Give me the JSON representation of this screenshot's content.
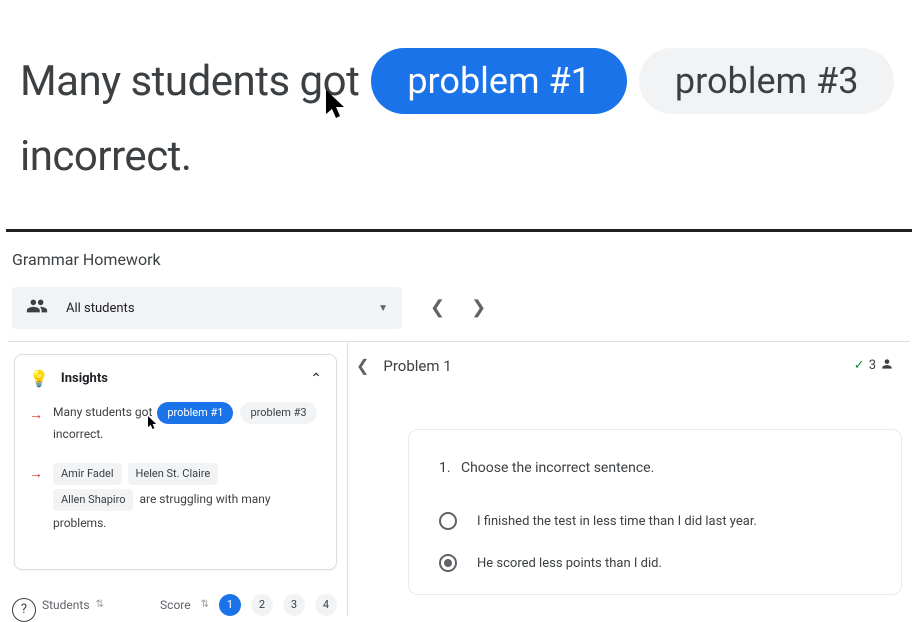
{
  "hero": {
    "prefix": "Many students got",
    "pill1": "problem #1",
    "pill3": "problem #3",
    "suffix": "incorrect."
  },
  "page": {
    "title": "Grammar Homework"
  },
  "toolbar": {
    "dropdown_label": "All students"
  },
  "insights": {
    "title": "Insights",
    "row1_prefix": "Many students got",
    "row1_pill1": "problem #1",
    "row1_pill3": "problem #3",
    "row1_suffix": "incorrect.",
    "row2_name1": "Amir Fadel",
    "row2_name2": "Helen St. Claire",
    "row2_name3": "Allen Shapiro",
    "row2_suffix": "are struggling with many problems."
  },
  "table": {
    "students_label": "Students",
    "score_label": "Score",
    "pages": [
      "1",
      "2",
      "3",
      "4"
    ]
  },
  "problem": {
    "title": "Problem 1",
    "correct_count": "3",
    "question_number": "1.",
    "question_text": "Choose the incorrect sentence.",
    "option_a": "I finished the test in less time than I did last year.",
    "option_b": "He scored less points than I did."
  }
}
